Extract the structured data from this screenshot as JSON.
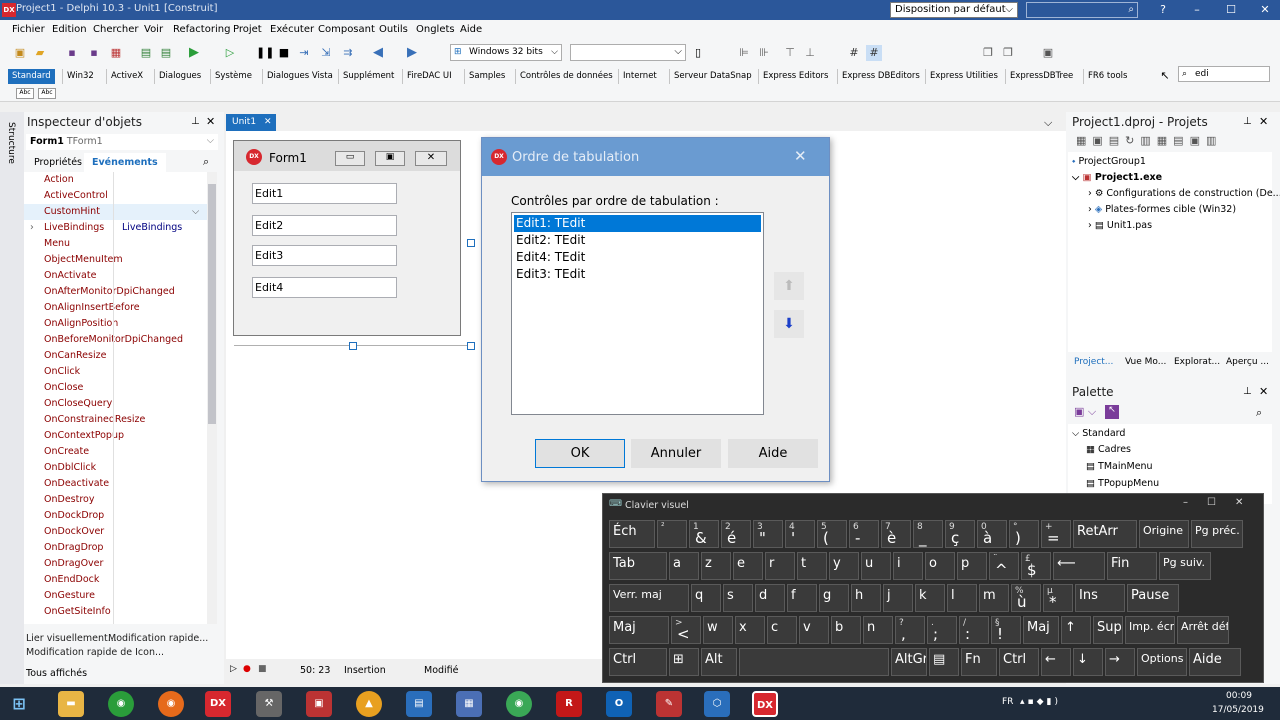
{
  "window": {
    "title": "Project1 - Delphi 10.3 - Unit1 [Construit]",
    "layout": "Disposition par défaut",
    "minimize": "–",
    "maximize": "☐",
    "close": "✕",
    "help": "?"
  },
  "menu": [
    "Fichier",
    "Edition",
    "Chercher",
    "Voir",
    "Refactoring",
    "Projet",
    "Exécuter",
    "Composant",
    "Outils",
    "Onglets",
    "Aide"
  ],
  "toolbar": {
    "platform": "Windows 32 bits"
  },
  "palette_tabs": [
    "Standard",
    "Win32",
    "ActiveX",
    "Dialogues",
    "Système",
    "Dialogues Vista",
    "Supplément",
    "FireDAC UI",
    "Samples",
    "Contrôles de données",
    "Internet",
    "Serveur DataSnap",
    "Express Editors",
    "Express DBEditors",
    "Express Utilities",
    "ExpressDBTree",
    "FR6 tools"
  ],
  "palette_search": "edi",
  "inspector": {
    "structure_label": "Structure",
    "title": "Inspecteur d'objets",
    "object_name": "Form1",
    "object_type": "TForm1",
    "tab_properties": "Propriétés",
    "tab_events": "Evénements",
    "events": [
      {
        "name": "Action",
        "value": ""
      },
      {
        "name": "ActiveControl",
        "value": ""
      },
      {
        "name": "CustomHint",
        "value": ""
      },
      {
        "name": "LiveBindings",
        "value": "LiveBindings"
      },
      {
        "name": "Menu",
        "value": ""
      },
      {
        "name": "ObjectMenuItem",
        "value": ""
      },
      {
        "name": "OnActivate",
        "value": ""
      },
      {
        "name": "OnAfterMonitorDpiChanged",
        "value": ""
      },
      {
        "name": "OnAlignInsertBefore",
        "value": ""
      },
      {
        "name": "OnAlignPosition",
        "value": ""
      },
      {
        "name": "OnBeforeMonitorDpiChanged",
        "value": ""
      },
      {
        "name": "OnCanResize",
        "value": ""
      },
      {
        "name": "OnClick",
        "value": ""
      },
      {
        "name": "OnClose",
        "value": ""
      },
      {
        "name": "OnCloseQuery",
        "value": ""
      },
      {
        "name": "OnConstrainedResize",
        "value": ""
      },
      {
        "name": "OnContextPopup",
        "value": ""
      },
      {
        "name": "OnCreate",
        "value": ""
      },
      {
        "name": "OnDblClick",
        "value": ""
      },
      {
        "name": "OnDeactivate",
        "value": ""
      },
      {
        "name": "OnDestroy",
        "value": ""
      },
      {
        "name": "OnDockDrop",
        "value": ""
      },
      {
        "name": "OnDockOver",
        "value": ""
      },
      {
        "name": "OnDragDrop",
        "value": ""
      },
      {
        "name": "OnDragOver",
        "value": ""
      },
      {
        "name": "OnEndDock",
        "value": ""
      },
      {
        "name": "OnGesture",
        "value": ""
      },
      {
        "name": "OnGetSiteInfo",
        "value": ""
      }
    ],
    "link1": "Lier visuellement...",
    "link2": "Modification rapide...",
    "link3": "Modification rapide de Icon...",
    "footer": "Tous affichés"
  },
  "editor": {
    "tab": "Unit1",
    "status_pos": "50: 23",
    "status_mode": "Insertion",
    "status_state": "Modifié"
  },
  "form1": {
    "title": "Form1",
    "edits": [
      "Edit1",
      "Edit2",
      "Edit3",
      "Edit4"
    ]
  },
  "dialog": {
    "title": "Ordre de tabulation",
    "label": "Contrôles par ordre de tabulation :",
    "items": [
      "Edit1: TEdit",
      "Edit2: TEdit",
      "Edit4: TEdit",
      "Edit3: TEdit"
    ],
    "ok": "OK",
    "cancel": "Annuler",
    "help": "Aide"
  },
  "projects": {
    "title": "Project1.dproj - Projets",
    "tree": [
      "ProjectGroup1",
      "Project1.exe",
      "Configurations de construction (De...",
      "Plates-formes cible (Win32)",
      "Unit1.pas"
    ],
    "tabs": [
      "Project...",
      "Vue Mo...",
      "Explorat...",
      "Aperçu ..."
    ]
  },
  "palette": {
    "title": "Palette",
    "category": "Standard",
    "items": [
      "Cadres",
      "TMainMenu",
      "TPopupMenu"
    ]
  },
  "keyboard": {
    "title": "Clavier visuel",
    "row1": [
      {
        "m": "Éch"
      },
      {
        "s": "²",
        "m": ""
      },
      {
        "s": "1",
        "m": "&"
      },
      {
        "s": "2",
        "m": "é"
      },
      {
        "s": "3",
        "m": "\""
      },
      {
        "s": "4",
        "m": "'"
      },
      {
        "s": "5",
        "m": "("
      },
      {
        "s": "6",
        "m": "-"
      },
      {
        "s": "7",
        "m": "è"
      },
      {
        "s": "8",
        "m": "_"
      },
      {
        "s": "9",
        "m": "ç"
      },
      {
        "s": "0",
        "m": "à"
      },
      {
        "s": "°",
        "m": ")"
      },
      {
        "s": "+",
        "m": "="
      },
      {
        "m": "RetArr"
      },
      {
        "m": "Origine"
      },
      {
        "m": "Pg préc."
      }
    ],
    "row2": [
      {
        "m": "Tab"
      },
      {
        "m": "a"
      },
      {
        "m": "z"
      },
      {
        "m": "e"
      },
      {
        "m": "r"
      },
      {
        "m": "t"
      },
      {
        "m": "y"
      },
      {
        "m": "u"
      },
      {
        "m": "i"
      },
      {
        "m": "o"
      },
      {
        "m": "p"
      },
      {
        "s": "¨",
        "m": "^"
      },
      {
        "s": "£",
        "m": "$"
      },
      {
        "m": "⟵"
      },
      {
        "m": "Fin"
      },
      {
        "m": "Pg suiv."
      }
    ],
    "row3": [
      {
        "m": "Verr. maj"
      },
      {
        "m": "q"
      },
      {
        "m": "s"
      },
      {
        "m": "d"
      },
      {
        "m": "f"
      },
      {
        "m": "g"
      },
      {
        "m": "h"
      },
      {
        "m": "j"
      },
      {
        "m": "k"
      },
      {
        "m": "l"
      },
      {
        "m": "m"
      },
      {
        "s": "%",
        "m": "ù"
      },
      {
        "s": "µ",
        "m": "*"
      },
      {
        "m": "Ins"
      },
      {
        "m": "Pause"
      }
    ],
    "row4": [
      {
        "m": "Maj"
      },
      {
        "s": ">",
        "m": "<"
      },
      {
        "m": "w"
      },
      {
        "m": "x"
      },
      {
        "m": "c"
      },
      {
        "m": "v"
      },
      {
        "m": "b"
      },
      {
        "m": "n"
      },
      {
        "s": "?",
        "m": ","
      },
      {
        "s": ".",
        "m": ";"
      },
      {
        "s": "/",
        "m": ":"
      },
      {
        "s": "§",
        "m": "!"
      },
      {
        "m": "Maj"
      },
      {
        "m": "↑"
      },
      {
        "m": "Suppr"
      },
      {
        "m": "Imp. écr."
      },
      {
        "m": "Arrêt défil"
      }
    ],
    "row5": [
      {
        "m": "Ctrl"
      },
      {
        "m": "⊞"
      },
      {
        "m": "Alt"
      },
      {
        "m": ""
      },
      {
        "m": "AltGr"
      },
      {
        "m": "▤"
      },
      {
        "m": "Fn"
      },
      {
        "m": "Ctrl"
      },
      {
        "m": "←"
      },
      {
        "m": "↓"
      },
      {
        "m": "→"
      },
      {
        "m": "Options"
      },
      {
        "m": "Aide"
      }
    ]
  },
  "taskbar": {
    "lang": "FR",
    "time": "00:09",
    "date": "17/05/2019"
  }
}
